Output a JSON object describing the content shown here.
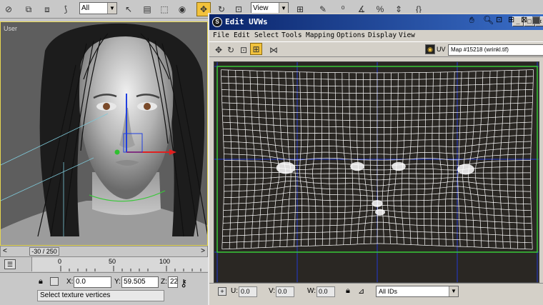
{
  "main_toolbar": {
    "selection_filter": "All",
    "reference_coord": "View"
  },
  "viewport": {
    "label": "User"
  },
  "timeline": {
    "frame_display": "-30 / 250"
  },
  "ruler": {
    "ticks": [
      "0",
      "50",
      "100"
    ]
  },
  "status": {
    "x_label": "X:",
    "x_value": "0.0",
    "y_label": "Y:",
    "y_value": "59.505",
    "z_label": "Z:",
    "z_value": "22",
    "prompt": "Select texture vertices"
  },
  "uvw_window": {
    "title": "Edit UVWs",
    "menu": [
      "File",
      "Edit",
      "Select",
      "Tools",
      "Mapping",
      "Options",
      "Display",
      "View"
    ],
    "uv_label": "UV",
    "map_select": "Map #15218 (wrinkl.tif)",
    "bottom": {
      "u_label": "U:",
      "u_value": "0.0",
      "v_label": "V:",
      "v_value": "0.0",
      "w_label": "W:",
      "w_value": "0.0",
      "ids_select": "All IDs"
    },
    "colors": {
      "title_start": "#0a246a",
      "title_end": "#3a6ec8",
      "canvas_bg": "#2a2723",
      "mesh_line": "#ffffff",
      "edge_line": "#38c838",
      "grid_line": "#2238d0"
    }
  }
}
